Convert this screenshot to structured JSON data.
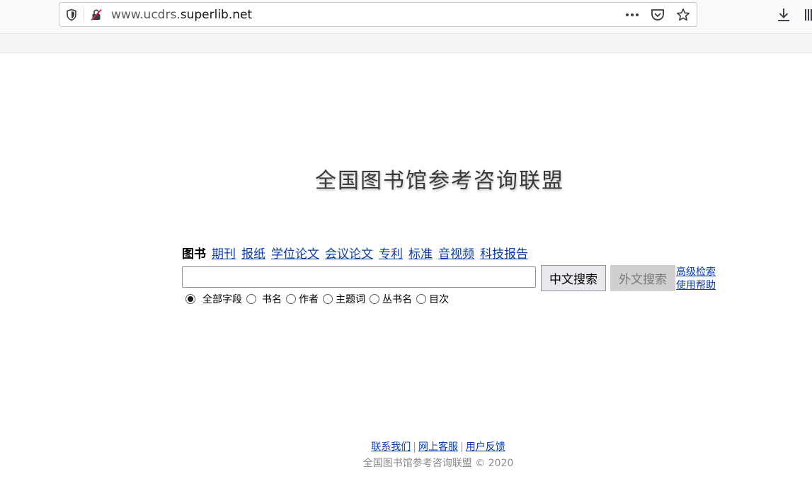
{
  "browser": {
    "url_prefix": "www.ucdrs.",
    "url_host": "superlib.net",
    "icons": {
      "shield": "shield-icon",
      "lock": "insecure-lock-icon",
      "more": "more-dots-icon",
      "pocket": "pocket-icon",
      "bookmark": "star-icon",
      "download": "download-icon",
      "library": "library-icon"
    }
  },
  "logo": {
    "title": "全国图书馆参考咨询联盟"
  },
  "tabs": [
    {
      "label": "图书",
      "active": true
    },
    {
      "label": "期刊"
    },
    {
      "label": "报纸"
    },
    {
      "label": "学位论文"
    },
    {
      "label": "会议论文"
    },
    {
      "label": "专利"
    },
    {
      "label": "标准"
    },
    {
      "label": "音视频"
    },
    {
      "label": "科技报告"
    }
  ],
  "search": {
    "value": "",
    "placeholder": "",
    "chinese_button": "中文搜索",
    "foreign_button": "外文搜索",
    "advanced_link": "高级检索",
    "help_link": "使用帮助"
  },
  "fields": [
    {
      "label": "全部字段",
      "checked": true
    },
    {
      "label": "书名"
    },
    {
      "label": "作者"
    },
    {
      "label": "主题词"
    },
    {
      "label": "丛书名"
    },
    {
      "label": "目次"
    }
  ],
  "footer": {
    "contact": "联系我们",
    "service": "网上客服",
    "feedback": "用户反馈",
    "separator": "|",
    "copyright": "全国图书馆参考咨询联盟 © 2020"
  },
  "colors": {
    "link": "#0b3ea8",
    "chrome_bg": "#f9f9fb",
    "disabled_button_bg": "#cfcfcf"
  }
}
